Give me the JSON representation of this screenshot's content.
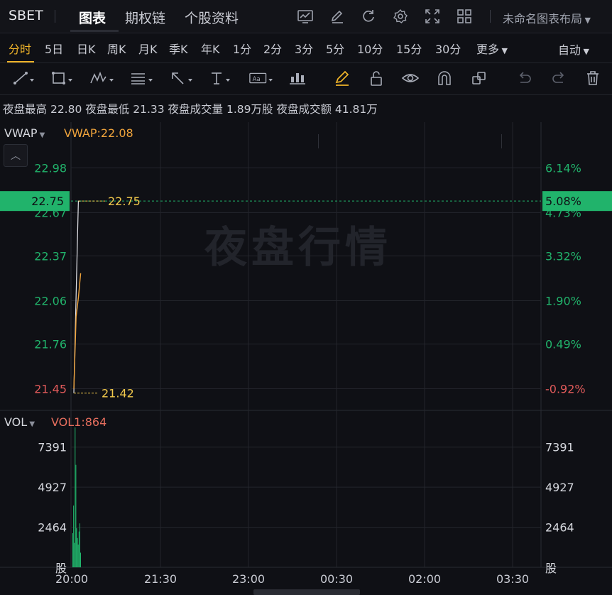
{
  "topbar": {
    "symbol": "SBET",
    "tabs": [
      "图表",
      "期权链",
      "个股资料"
    ],
    "layout_name": "未命名图表布局",
    "icons": [
      "chart-template-icon",
      "pencil-edit-icon",
      "refresh-icon",
      "settings-gear-icon",
      "fullscreen-icon",
      "grid-layout-icon"
    ]
  },
  "periods": {
    "items": [
      "分时",
      "5日",
      "日K",
      "周K",
      "月K",
      "季K",
      "年K",
      "1分",
      "2分",
      "3分",
      "5分",
      "10分",
      "15分",
      "30分",
      "更多"
    ],
    "active": "分时",
    "scale_mode": "自动"
  },
  "tools": [
    "trend-line-icon",
    "rectangle-icon",
    "pattern-icon",
    "fib-icon",
    "arrow-icon",
    "text-icon",
    "note-icon",
    "measure-icon",
    "highlighter-icon",
    "lock-icon",
    "eye-icon",
    "magnet-icon",
    "layers-icon",
    "undo-icon",
    "redo-icon",
    "trash-icon"
  ],
  "info": {
    "high_label": "夜盘最高",
    "high": "22.80",
    "low_label": "夜盘最低",
    "low": "21.33",
    "volume_label": "夜盘成交量",
    "volume": "1.89万股",
    "amount_label": "夜盘成交额",
    "amount": "41.81万"
  },
  "watermark": "夜盘行情",
  "price_panel": {
    "indicator": "VWAP",
    "indicator_value": "VWAP:22.08",
    "left_ticks": [
      "22.98",
      "22.67",
      "22.37",
      "22.06",
      "21.76",
      "21.45"
    ],
    "right_ticks": [
      "6.14%",
      "4.73%",
      "3.32%",
      "1.90%",
      "0.49%",
      "-0.92%"
    ],
    "current_price": "22.75",
    "current_pct": "5.08%",
    "max_marker": "22.75",
    "min_marker": "21.42"
  },
  "volume_panel": {
    "indicator": "VOL",
    "indicator_value": "VOL1:864",
    "left_ticks": [
      "7391",
      "4927",
      "2464"
    ],
    "right_ticks": [
      "7391",
      "4927",
      "2464"
    ],
    "unit": "股"
  },
  "x_ticks": [
    "20:00",
    "21:30",
    "23:00",
    "00:30",
    "02:00",
    "03:30"
  ],
  "colors": {
    "up": "#21b36b",
    "down": "#e05a5a",
    "vwap": "#f0a43c",
    "accent": "#f0b429",
    "price_line": "#e6e7ec"
  },
  "chart_data": {
    "type": "line",
    "x_range": [
      "20:00",
      "03:30"
    ],
    "price_range": [
      21.3,
      23.1
    ],
    "ref_close": 21.65,
    "price_series": [
      {
        "t": "20:00",
        "v": 21.42
      },
      {
        "t": "20:01",
        "v": 22.1
      },
      {
        "t": "20:02",
        "v": 22.75
      },
      {
        "t": "20:03",
        "v": 22.75
      }
    ],
    "vwap_series": [
      {
        "t": "20:00",
        "v": 21.45
      },
      {
        "t": "20:01",
        "v": 21.95
      },
      {
        "t": "20:02",
        "v": 22.08
      },
      {
        "t": "20:03",
        "v": 22.25
      }
    ],
    "volume_ylim": [
      0,
      8600
    ],
    "volume": [
      2100,
      3800,
      1500,
      8600,
      6300,
      2400,
      1800,
      1400,
      2200,
      2700,
      900
    ]
  }
}
